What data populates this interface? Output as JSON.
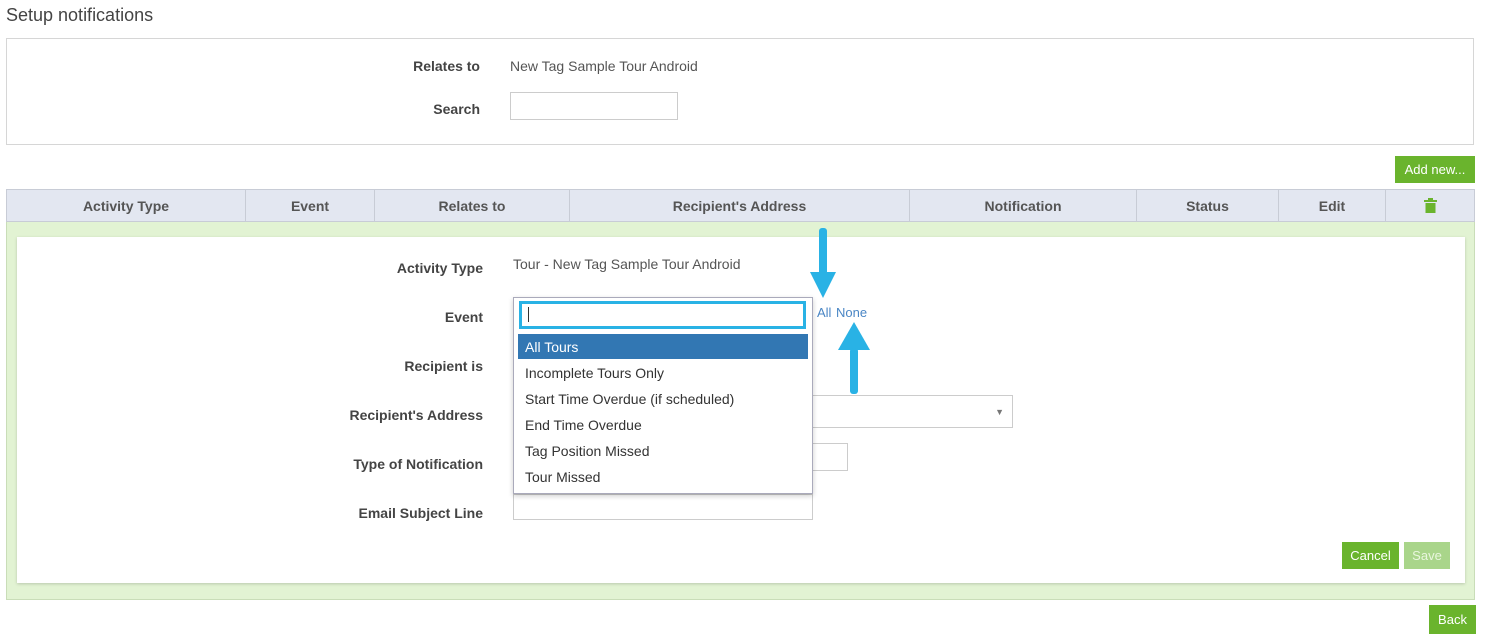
{
  "page_title": "Setup notifications",
  "filter": {
    "relates_to_label": "Relates to",
    "relates_to_value": "New Tag Sample Tour Android",
    "search_label": "Search",
    "search_value": ""
  },
  "add_new_label": "Add new...",
  "columns": [
    "Activity Type",
    "Event",
    "Relates to",
    "Recipient's Address",
    "Notification",
    "Status",
    "Edit"
  ],
  "delete_icon": "trash-icon",
  "form": {
    "activity_type_label": "Activity Type",
    "activity_type_value": "Tour - New Tag Sample Tour Android",
    "event_label": "Event",
    "recipient_is_label": "Recipient is",
    "recipient_address_label": "Recipient's Address",
    "type_of_notification_label": "Type of Notification",
    "email_subject_label": "Email Subject Line",
    "select_all_label": "All",
    "select_none_label": "None",
    "cancel_label": "Cancel",
    "save_label": "Save"
  },
  "event_dropdown": {
    "search_value": "",
    "selected": "All Tours",
    "options": [
      "All Tours",
      "Incomplete Tours Only",
      "Start Time Overdue (if scheduled)",
      "End Time Overdue",
      "Tag Position Missed",
      "Tour Missed"
    ]
  },
  "back_label": "Back",
  "colors": {
    "accent_green": "#6ab42d",
    "highlight_blue": "#3277b3",
    "annotation_arrow": "#29b2e5",
    "header_bg": "#e3e7f1",
    "edit_bg": "#e2f3d3"
  }
}
